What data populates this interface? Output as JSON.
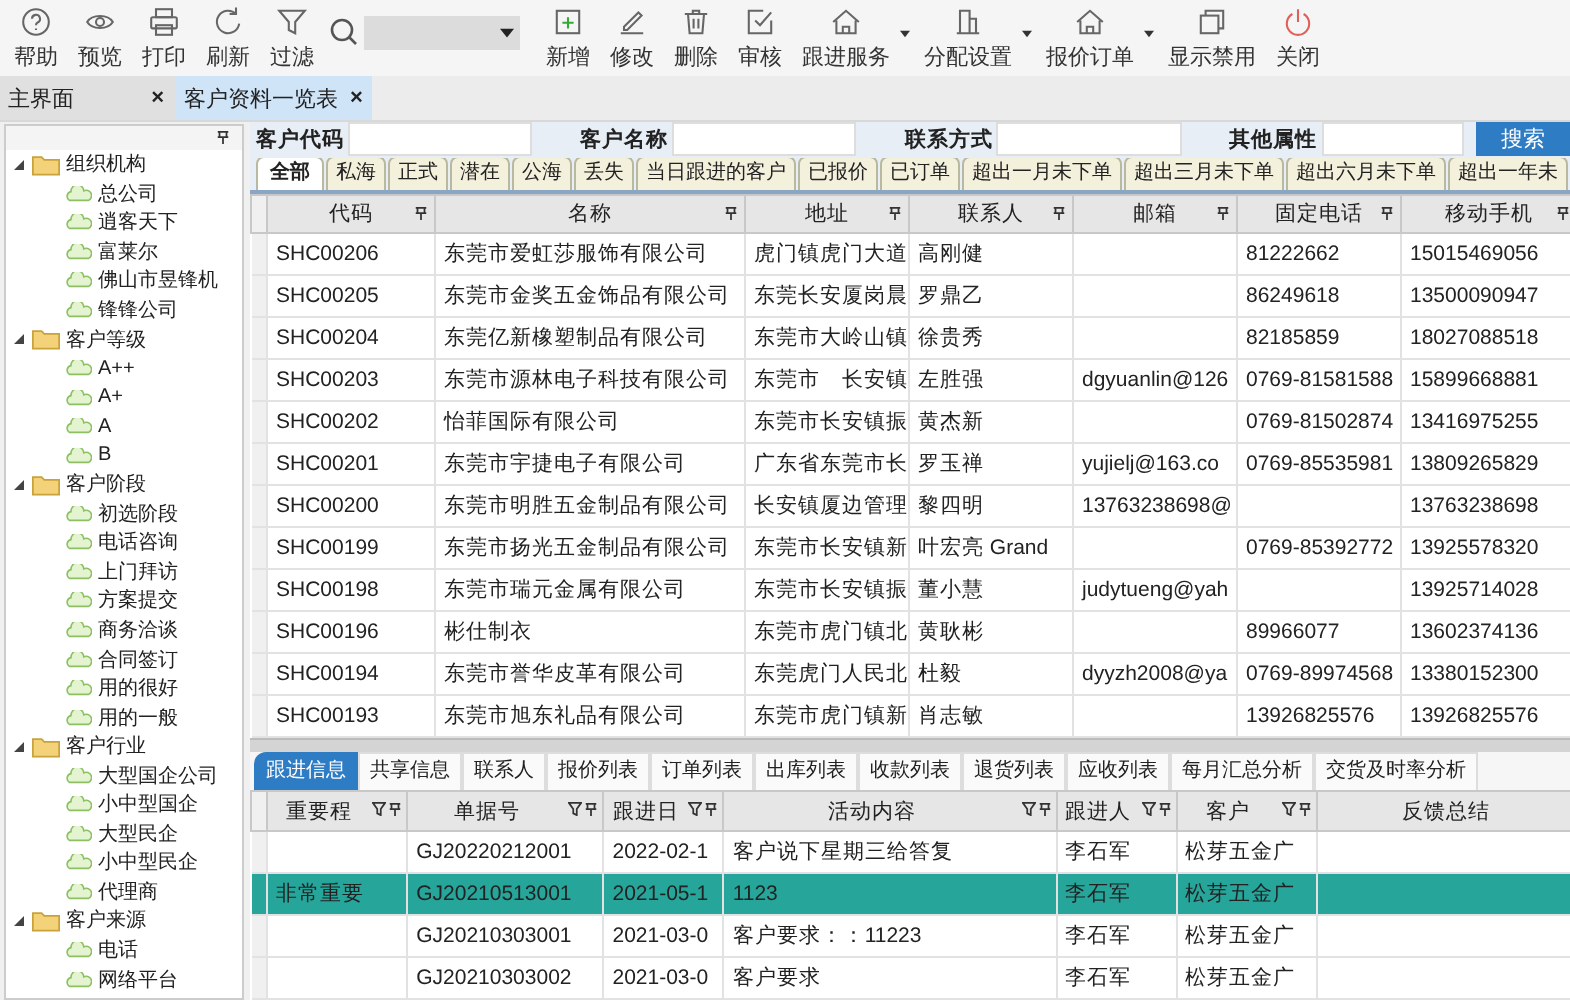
{
  "toolbar": {
    "items": [
      {
        "label": "帮助",
        "kind": "button"
      },
      {
        "label": "预览",
        "kind": "button"
      },
      {
        "label": "打印",
        "kind": "button"
      },
      {
        "label": "刷新",
        "kind": "button"
      },
      {
        "label": "过滤",
        "kind": "button"
      },
      {
        "kind": "search"
      },
      {
        "label": "新增",
        "kind": "button"
      },
      {
        "label": "修改",
        "kind": "button"
      },
      {
        "label": "删除",
        "kind": "button"
      },
      {
        "label": "审核",
        "kind": "button"
      },
      {
        "label": "跟进服务",
        "kind": "menu"
      },
      {
        "label": "分配设置",
        "kind": "menu"
      },
      {
        "label": "报价订单",
        "kind": "menu"
      },
      {
        "label": "显示禁用",
        "kind": "button"
      },
      {
        "label": "关闭",
        "kind": "danger"
      }
    ]
  },
  "doc_tabs": [
    {
      "label": "主界面",
      "selected": false,
      "close": "×"
    },
    {
      "label": "客户资料一览表",
      "selected": true,
      "close": "×"
    }
  ],
  "tree": {
    "groups": [
      {
        "label": "组织机构",
        "expanded": true,
        "children": [
          {
            "label": "总公司"
          },
          {
            "label": "逍客天下"
          },
          {
            "label": "富莱尔"
          },
          {
            "label": "佛山市昱锋机"
          },
          {
            "label": "锋锋公司"
          }
        ]
      },
      {
        "label": "客户等级",
        "expanded": true,
        "children": [
          {
            "label": "A++"
          },
          {
            "label": "A+"
          },
          {
            "label": "A"
          },
          {
            "label": "B"
          }
        ]
      },
      {
        "label": "客户阶段",
        "expanded": true,
        "children": [
          {
            "label": "初选阶段"
          },
          {
            "label": "电话咨询"
          },
          {
            "label": "上门拜访"
          },
          {
            "label": "方案提交"
          },
          {
            "label": "商务洽谈"
          },
          {
            "label": "合同签订"
          },
          {
            "label": "用的很好"
          },
          {
            "label": "用的一般"
          }
        ]
      },
      {
        "label": "客户行业",
        "expanded": true,
        "children": [
          {
            "label": "大型国企公司"
          },
          {
            "label": "小中型国企"
          },
          {
            "label": "大型民企"
          },
          {
            "label": "小中型民企"
          },
          {
            "label": "代理商"
          }
        ]
      },
      {
        "label": "客户来源",
        "expanded": true,
        "children": [
          {
            "label": "电话"
          },
          {
            "label": "网络平台"
          }
        ]
      }
    ]
  },
  "search_form": {
    "fields": [
      {
        "label": "客户代码"
      },
      {
        "label": "客户名称"
      },
      {
        "label": "联系方式"
      },
      {
        "label": "其他属性"
      }
    ],
    "button": "搜索"
  },
  "filter_tabs": [
    {
      "label": "全部",
      "selected": true
    },
    {
      "label": "私海",
      "selected": false
    },
    {
      "label": "正式",
      "selected": false
    },
    {
      "label": "潜在",
      "selected": false
    },
    {
      "label": "公海",
      "selected": false
    },
    {
      "label": "丢失",
      "selected": false
    },
    {
      "label": "当日跟进的客户",
      "selected": false
    },
    {
      "label": "已报价",
      "selected": false
    },
    {
      "label": "已订单",
      "selected": false
    },
    {
      "label": "超出一月未下单",
      "selected": false
    },
    {
      "label": "超出三月未下单",
      "selected": false
    },
    {
      "label": "超出六月未下单",
      "selected": false
    },
    {
      "label": "超出一年未",
      "selected": false
    }
  ],
  "customer_table": {
    "columns": [
      "代码",
      "名称",
      "地址",
      "联系人",
      "邮箱",
      "固定电话",
      "移动手机"
    ],
    "rows": [
      {
        "selected": false,
        "cells": [
          "SHC00206",
          "东莞市爱虹莎服饰有限公司",
          "虎门镇虎门大道",
          "高刚健",
          "",
          "81222662",
          "15015469056"
        ]
      },
      {
        "selected": false,
        "cells": [
          "SHC00205",
          "东莞市金奖五金饰品有限公司",
          "东莞长安厦岗晨",
          "罗鼎乙",
          "",
          "86249618",
          "13500090947"
        ]
      },
      {
        "selected": false,
        "cells": [
          "SHC00204",
          "东莞亿新橡塑制品有限公司",
          "东莞市大岭山镇",
          "徐贵秀",
          "",
          "82185859",
          "18027088518"
        ]
      },
      {
        "selected": false,
        "cells": [
          "SHC00203",
          "东莞市源林电子科技有限公司",
          "东莞市　长安镇",
          "左胜强",
          "dgyuanlin@126",
          "0769-81581588",
          "15899668881"
        ]
      },
      {
        "selected": false,
        "cells": [
          "SHC00202",
          "怡菲国际有限公司",
          "东莞市长安镇振",
          "黄杰新",
          "",
          "0769-81502874",
          "13416975255"
        ]
      },
      {
        "selected": false,
        "cells": [
          "SHC00201",
          "东莞市宇捷电子有限公司",
          "广东省东莞市长",
          "罗玉禅",
          "yujielj@163.co",
          "0769-85535981",
          "13809265829"
        ]
      },
      {
        "selected": false,
        "cells": [
          "SHC00200",
          "东莞市明胜五金制品有限公司",
          "长安镇厦边管理",
          "黎四明",
          "13763238698@",
          "",
          "13763238698"
        ]
      },
      {
        "selected": false,
        "cells": [
          "SHC00199",
          "东莞市扬光五金制品有限公司",
          "东莞市长安镇新",
          "叶宏亮 Grand",
          "",
          "0769-85392772",
          "13925578320"
        ]
      },
      {
        "selected": false,
        "cells": [
          "SHC00198",
          "东莞市瑞元金属有限公司",
          "东莞市长安镇振",
          "董小慧",
          "judytueng@yah",
          "",
          "13925714028"
        ]
      },
      {
        "selected": false,
        "cells": [
          "SHC00196",
          "彬仕制衣",
          "东莞市虎门镇北",
          "黄耿彬",
          "",
          "89966077",
          "13602374136"
        ]
      },
      {
        "selected": false,
        "cells": [
          "SHC00194",
          "东莞市誉华皮革有限公司",
          "东莞虎门人民北",
          "杜毅",
          "dyyzh2008@ya",
          "0769-89974568",
          "13380152300"
        ]
      },
      {
        "selected": false,
        "cells": [
          "SHC00193",
          "东莞市旭东礼品有限公司",
          "东莞市虎门镇新",
          "肖志敏",
          "",
          "13926825576",
          "13926825576"
        ]
      }
    ]
  },
  "detail_tabs": [
    {
      "label": "跟进信息",
      "selected": true
    },
    {
      "label": "共享信息",
      "selected": false
    },
    {
      "label": "联系人",
      "selected": false
    },
    {
      "label": "报价列表",
      "selected": false
    },
    {
      "label": "订单列表",
      "selected": false
    },
    {
      "label": "出库列表",
      "selected": false
    },
    {
      "label": "收款列表",
      "selected": false
    },
    {
      "label": "退货列表",
      "selected": false
    },
    {
      "label": "应收列表",
      "selected": false
    },
    {
      "label": "每月汇总分析",
      "selected": false
    },
    {
      "label": "交货及时率分析",
      "selected": false
    }
  ],
  "followup_table": {
    "columns": [
      {
        "label": "重要程",
        "filterable": true
      },
      {
        "label": "单据号",
        "filterable": true
      },
      {
        "label": "跟进日",
        "filterable": true
      },
      {
        "label": "活动内容",
        "filterable": true
      },
      {
        "label": "跟进人",
        "filterable": true
      },
      {
        "label": "客户",
        "filterable": true
      },
      {
        "label": "反馈总结",
        "filterable": false
      }
    ],
    "rows": [
      {
        "selected": false,
        "cells": [
          "",
          "GJ20220212001",
          "2022-02-1",
          "客户说下星期三给答复",
          "李石军",
          "松芽五金广",
          ""
        ]
      },
      {
        "selected": true,
        "cells": [
          "非常重要",
          "GJ20210513001",
          "2021-05-1",
          "1123",
          "李石军",
          "松芽五金广",
          ""
        ]
      },
      {
        "selected": false,
        "cells": [
          "",
          "GJ20210303001",
          "2021-03-0",
          "客户要求：：11223",
          "李石军",
          "松芽五金广",
          ""
        ]
      },
      {
        "selected": false,
        "cells": [
          "",
          "GJ20210303002",
          "2021-03-0",
          "客户要求",
          "李石军",
          "松芽五金广",
          ""
        ]
      }
    ]
  }
}
